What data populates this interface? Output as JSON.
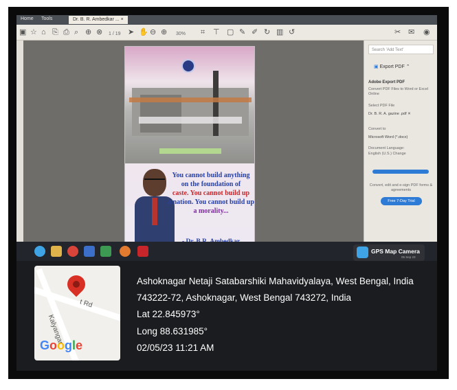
{
  "browser": {
    "tabs": [
      "Home",
      "Tools",
      "Dr. B. R. Ambedkar ..."
    ],
    "tab_close": "×"
  },
  "toolbar": {
    "page_indicator": "1 / 19",
    "zoom": "30%",
    "icons": [
      "save-icon",
      "star-icon",
      "upload-icon",
      "download-icon",
      "print-icon",
      "zoom-search-icon",
      "page-up-icon",
      "page-down-icon",
      "cursor-icon",
      "hand-icon",
      "zoom-out-icon",
      "zoom-in-icon",
      "crop-icon",
      "sign-icon",
      "comment-icon",
      "pen-icon",
      "highlight-icon",
      "rotate-icon",
      "delete-icon",
      "refresh-icon",
      "share-icon",
      "mail-icon",
      "user-icon"
    ]
  },
  "poster": {
    "quote_lines": [
      "You cannot build anything",
      "on the foundation of",
      "caste. You cannot build up",
      "a nation. You cannot build up",
      "a morality..."
    ],
    "author": "- Dr. B.R. Ambedkar"
  },
  "right_panel": {
    "search_placeholder": "Search 'Add Text'",
    "export_pdf_label": "Export PDF",
    "adobe_export_title": "Adobe Export PDF",
    "convert_desc": "Convert PDF Files to Word or Excel Online",
    "select_pdf_label": "Select PDF File",
    "selected_file": "Dr. B. R. A. gazine .pdf",
    "convert_to_label": "Convert to",
    "convert_to_value": "Microsoft Word (*.docx)",
    "doc_language_label": "Document Language:",
    "doc_language_value": "English (U.S.) Change",
    "promo_text": "Convert, edit and e-sign PDF forms & agreements",
    "trial_button": "Free 7-Day Trial"
  },
  "taskbar": {
    "apps": [
      "chrome-icon",
      "file-explorer-icon",
      "opera-icon",
      "word-icon",
      "excel-icon",
      "firefox-icon",
      "acrobat-icon"
    ]
  },
  "gps_camera": {
    "badge_label": "GPS Map Camera",
    "badge_sub": "05 Sep 23",
    "map_road_label": "t Rd",
    "map_area_label": "Kalyangar",
    "map_brand": "Google",
    "address_line1": "Ashoknagar Netaji Satabarshiki Mahavidyalaya, West Bengal, India",
    "address_line2": "743222-72, Ashoknagar, West Bengal 743272, India",
    "lat": "Lat 22.845973°",
    "long": "Long 88.631985°",
    "datetime": "02/05/23 11:21 AM"
  },
  "colors": {
    "frame_bg": "#0b0b0b",
    "quote_blue": "#2640a8",
    "quote_red": "#c8262a",
    "quote_green": "#2f8f3a",
    "quote_purple": "#7a2d9a",
    "adobe_blue": "#2e7bd6",
    "map_pin": "#d93025"
  }
}
